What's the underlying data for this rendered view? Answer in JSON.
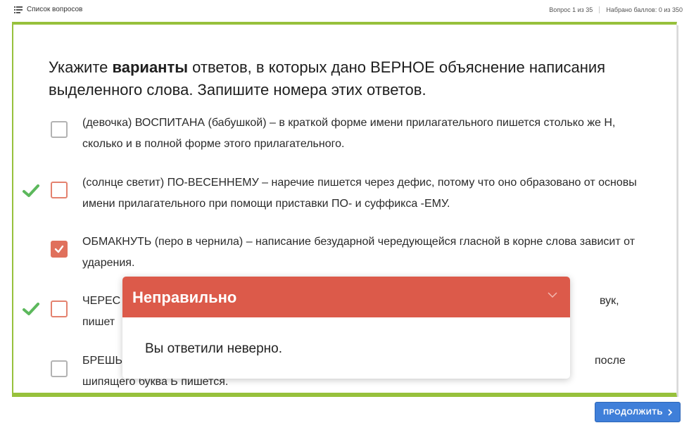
{
  "topbar": {
    "question_list_label": "Список вопросов",
    "question_progress": "Вопрос 1 из 35",
    "score": "Набрано баллов: 0 из 350"
  },
  "question": {
    "prefix": "Укажите ",
    "bold": "варианты",
    "rest": " ответов, в которых дано ВЕРНОЕ объяснение написания выделенного слова. Запишите номера этих ответов."
  },
  "options": [
    {
      "text": "(девочка) ВОСПИТАНА (бабушкой) – в краткой форме имени прилагательного пишется столько же Н, сколько и в полной форме этого прилагательного.",
      "checked": false,
      "correct": false
    },
    {
      "text": "(солнце светит) ПО-ВЕСЕННЕМУ – наречие пишется через дефис, потому что оно образовано от основы имени прилагательного при помощи приставки ПО- и суффикса -ЕМУ.",
      "checked": false,
      "correct": true
    },
    {
      "text": "ОБМАКНУТЬ (перо в чернила) – написание безударной чередующейся гласной в корне слова зависит от ударения.",
      "checked": true,
      "correct": false
    },
    {
      "text": "ЧЕРЕС",
      "text_right": "вук,",
      "text_line2": "пишет",
      "checked": false,
      "correct": true
    },
    {
      "text": "БРЕШЬ",
      "text_right": "после",
      "text_line2": "шипящего буква Ь пишется.",
      "checked": false,
      "correct": false
    }
  ],
  "popup": {
    "title": "Неправильно",
    "message": "Вы ответили неверно."
  },
  "continue_label": "ПРОДОЛЖИТЬ",
  "colors": {
    "accent_green": "#97c13c",
    "error_red": "#dc5a4a",
    "button_blue": "#3f7fd9",
    "check_green": "#5cb85c"
  }
}
